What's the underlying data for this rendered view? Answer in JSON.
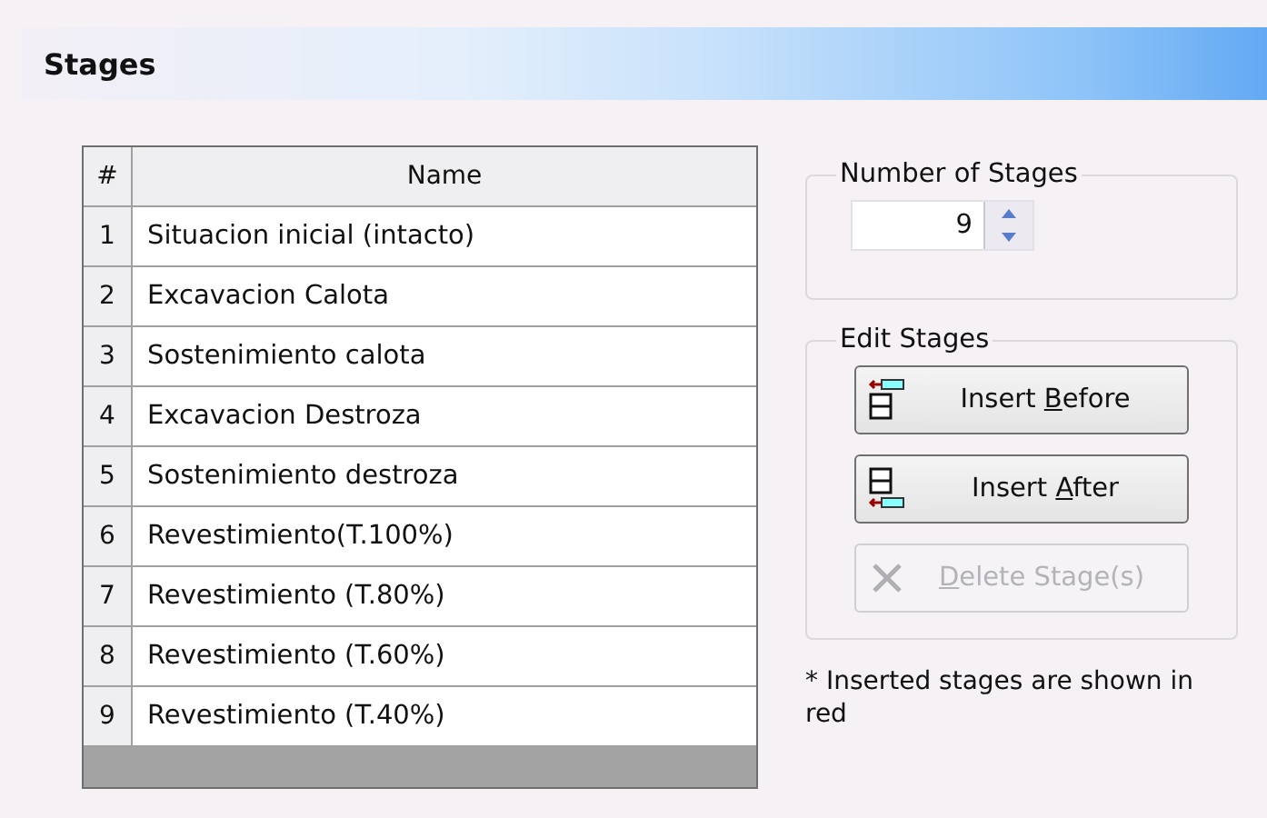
{
  "header": {
    "title": "Stages"
  },
  "table": {
    "columns": [
      "#",
      "Name"
    ],
    "rows": [
      {
        "number": "1",
        "name": "Situacion inicial (intacto)"
      },
      {
        "number": "2",
        "name": "Excavacion Calota"
      },
      {
        "number": "3",
        "name": "Sostenimiento calota"
      },
      {
        "number": "4",
        "name": "Excavacion Destroza"
      },
      {
        "number": "5",
        "name": "Sostenimiento destroza"
      },
      {
        "number": "6",
        "name": "Revestimiento(T.100%)"
      },
      {
        "number": "7",
        "name": "Revestimiento (T.80%)"
      },
      {
        "number": "8",
        "name": "Revestimiento (T.60%)"
      },
      {
        "number": "9",
        "name": "Revestimiento (T.40%)"
      }
    ]
  },
  "number_of_stages": {
    "title": "Number of Stages",
    "value": "9"
  },
  "edit_stages": {
    "title": "Edit Stages",
    "buttons": [
      {
        "kind": "insert-before",
        "before": "Insert ",
        "key": "B",
        "after": "efore",
        "disabled": false
      },
      {
        "kind": "insert-after",
        "before": "Insert ",
        "key": "A",
        "after": "fter",
        "disabled": false
      },
      {
        "kind": "delete",
        "key": "D",
        "after": "elete Stage(s)",
        "disabled": true
      }
    ]
  },
  "note": "* Inserted stages are shown in red"
}
